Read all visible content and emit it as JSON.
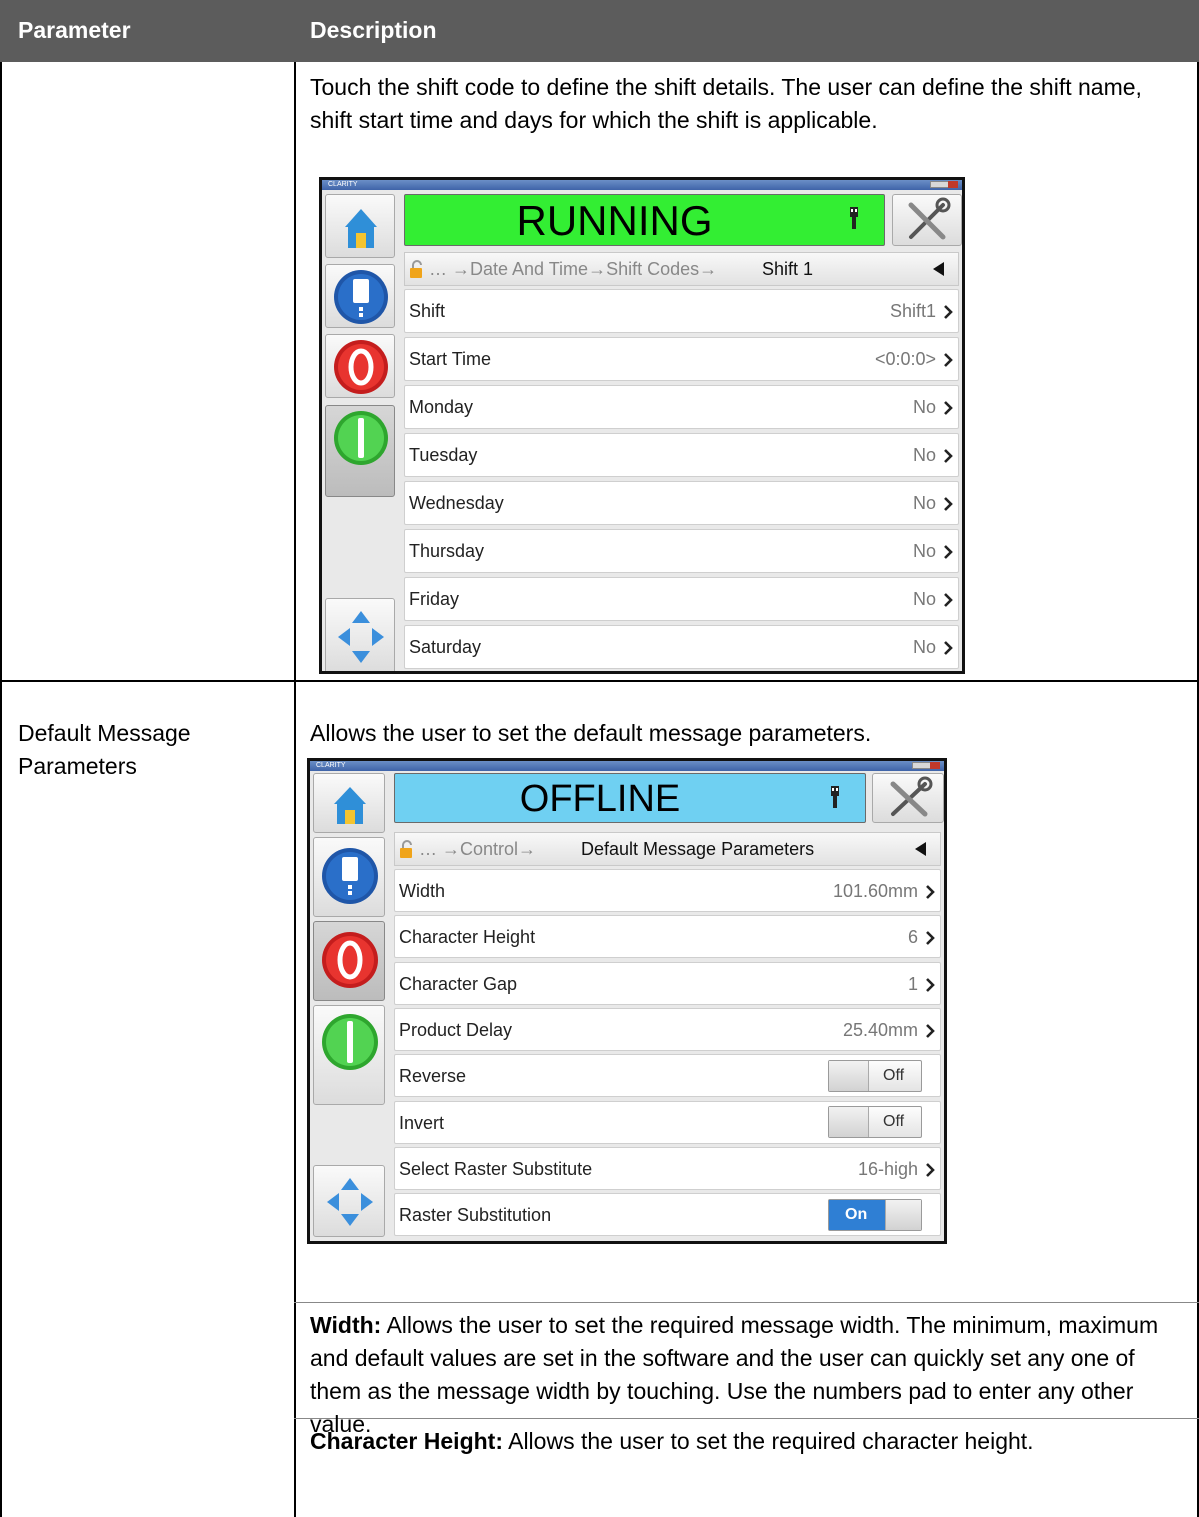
{
  "table": {
    "col_parameter": "Parameter",
    "col_description": "Description"
  },
  "row1": {
    "description": "Touch the shift code to define the shift details. The user can define the shift name, shift start time and days for which the shift is applicable.",
    "screen": {
      "app_title": "CLARITY",
      "status": "RUNNING",
      "status_color": "#33ee33",
      "breadcrumb_prefix": "… →Date And Time→Shift Codes→",
      "breadcrumb_current": "Shift 1",
      "items": [
        {
          "label": "Shift",
          "value": "Shift1"
        },
        {
          "label": "Start Time",
          "value": "<0:0:0>"
        },
        {
          "label": "Monday",
          "value": "No"
        },
        {
          "label": "Tuesday",
          "value": "No"
        },
        {
          "label": "Wednesday",
          "value": "No"
        },
        {
          "label": "Thursday",
          "value": "No"
        },
        {
          "label": "Friday",
          "value": "No"
        },
        {
          "label": "Saturday",
          "value": "No"
        }
      ]
    }
  },
  "row2": {
    "parameter": "Default Message Parameters",
    "description": "Allows the user to set the default message parameters.",
    "screen": {
      "app_title": "CLARITY",
      "status": "OFFLINE",
      "status_color": "#6fd0f2",
      "breadcrumb_prefix": "… →Control→",
      "breadcrumb_current": "Default Message Parameters",
      "items": [
        {
          "label": "Width",
          "value": "101.60mm"
        },
        {
          "label": "Character Height",
          "value": "6"
        },
        {
          "label": "Character Gap",
          "value": "1"
        },
        {
          "label": "Product Delay",
          "value": "25.40mm"
        },
        {
          "label": "Reverse",
          "toggle": "Off"
        },
        {
          "label": "Invert",
          "toggle": "Off"
        },
        {
          "label": "Select Raster Substitute",
          "value": "16-high"
        },
        {
          "label": "Raster Substitution",
          "toggle": "On"
        }
      ]
    },
    "width_term": "Width:",
    "width_desc": " Allows the user to set the required message width. The minimum, maximum and default values are set in the software and the user can quickly set any one of them as the message width by touching. Use the numbers pad to enter any other value.",
    "charheight_term": "Character Height:",
    "charheight_desc": " Allows the user to set the required character height."
  }
}
